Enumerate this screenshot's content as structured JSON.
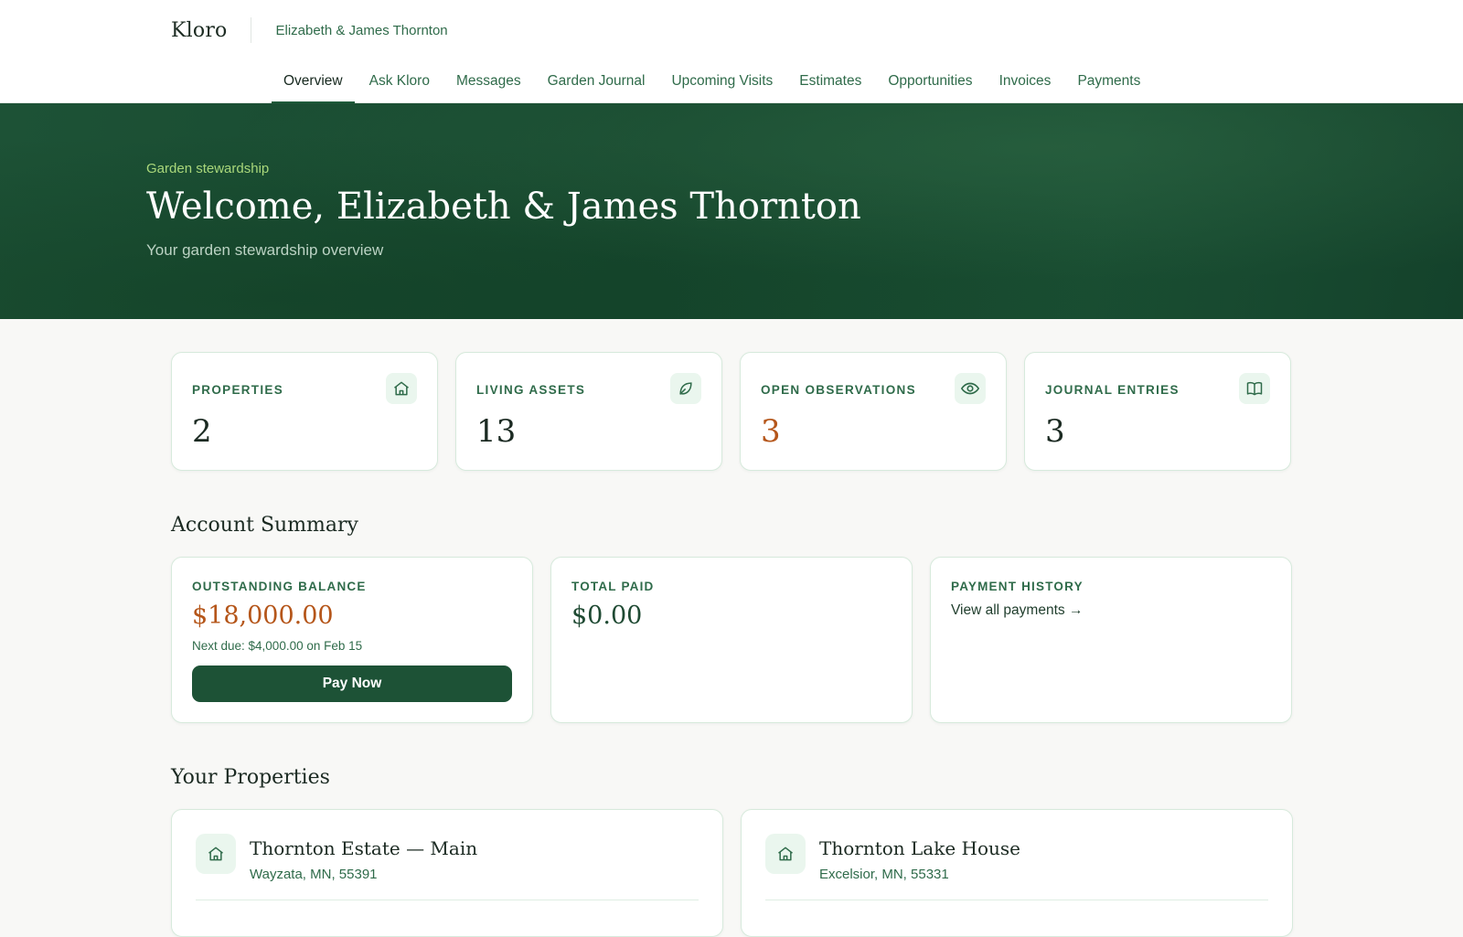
{
  "app": {
    "logo": "Kloro",
    "client_name": "Elizabeth & James Thornton"
  },
  "nav": {
    "items": [
      {
        "label": "Overview",
        "active": true
      },
      {
        "label": "Ask Kloro"
      },
      {
        "label": "Messages"
      },
      {
        "label": "Garden Journal"
      },
      {
        "label": "Upcoming Visits"
      },
      {
        "label": "Estimates"
      },
      {
        "label": "Opportunities"
      },
      {
        "label": "Invoices"
      },
      {
        "label": "Payments"
      }
    ]
  },
  "hero": {
    "kicker": "Garden stewardship",
    "title": "Welcome, Elizabeth & James Thornton",
    "subtitle": "Your garden stewardship overview"
  },
  "stats": [
    {
      "label": "PROPERTIES",
      "value": "2",
      "icon": "home-icon"
    },
    {
      "label": "LIVING ASSETS",
      "value": "13",
      "icon": "leaf-icon"
    },
    {
      "label": "OPEN OBSERVATIONS",
      "value": "3",
      "icon": "eye-icon",
      "accent": "#b5561a"
    },
    {
      "label": "JOURNAL ENTRIES",
      "value": "3",
      "icon": "book-icon"
    }
  ],
  "account_summary": {
    "title": "Account Summary",
    "outstanding": {
      "label": "OUTSTANDING BALANCE",
      "amount": "$18,000.00",
      "next_due": "Next due: $4,000.00 on Feb 15",
      "button": "Pay Now"
    },
    "total_paid": {
      "label": "TOTAL PAID",
      "amount": "$0.00"
    },
    "payment_history": {
      "label": "PAYMENT HISTORY",
      "link": "View all payments →"
    }
  },
  "properties": {
    "title": "Your Properties",
    "items": [
      {
        "name": "Thornton Estate — Main",
        "address": "Wayzata, MN, 55391"
      },
      {
        "name": "Thornton Lake House",
        "address": "Excelsior, MN, 55331"
      }
    ]
  },
  "colors": {
    "brand": "#1d5236",
    "accent_warning": "#b5561a",
    "link": "#2f6b4a",
    "hero_kicker": "#a9d77a"
  }
}
